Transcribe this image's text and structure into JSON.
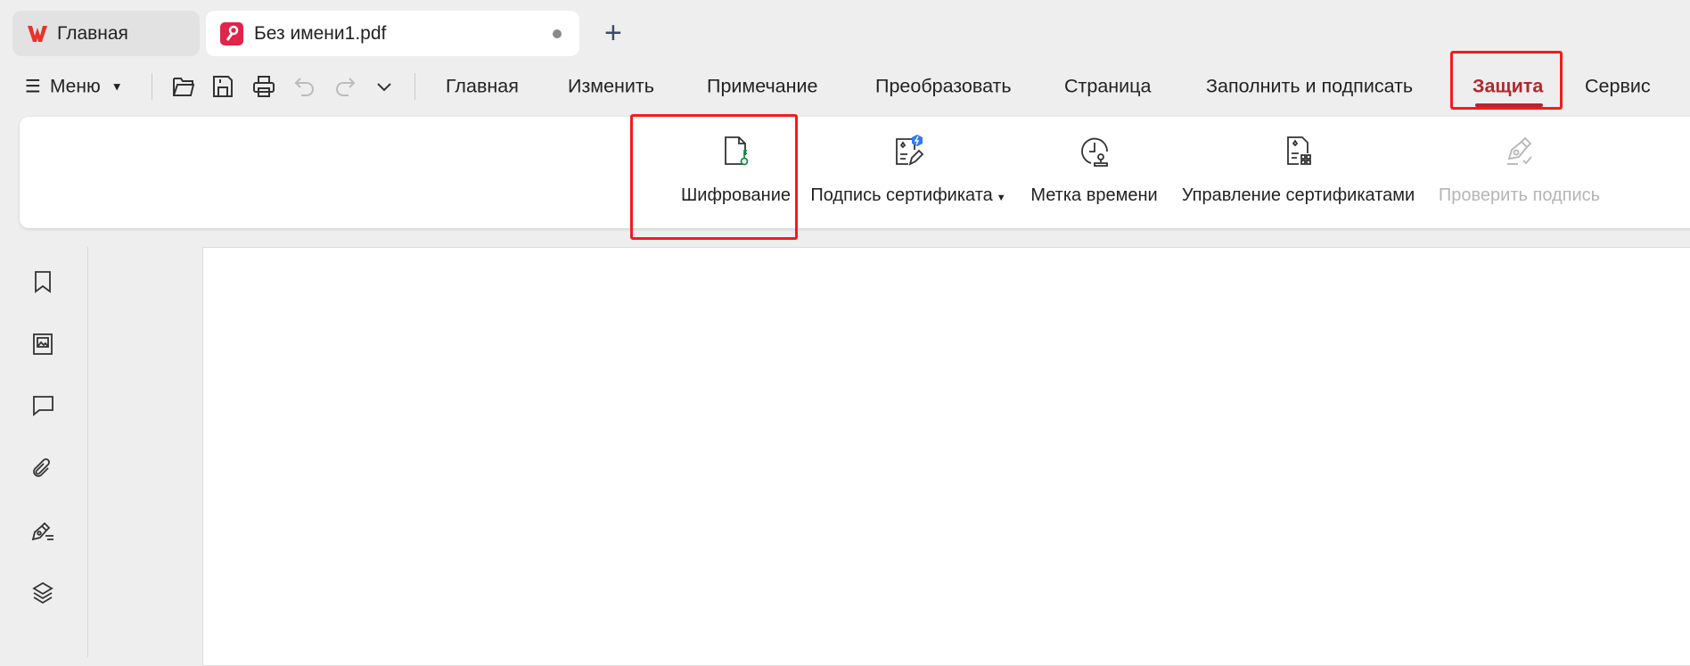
{
  "tabs": [
    {
      "label": "Главная",
      "icon": "wps-logo-icon"
    },
    {
      "label": "Без имени1.pdf",
      "icon": "pdf-icon",
      "unsaved": true
    }
  ],
  "new_tab_label": "+",
  "toolbar": {
    "menu_label": "Меню",
    "quick_icons": [
      "open-folder-icon",
      "save-icon",
      "print-icon",
      "undo-icon",
      "redo-icon",
      "chevron-down-icon"
    ]
  },
  "ribbon_tabs": [
    "Главная",
    "Изменить",
    "Примечание",
    "Преобразовать",
    "Страница",
    "Заполнить и подписать",
    "Защита",
    "Сервис"
  ],
  "active_tab": "Защита",
  "ribbon_buttons": [
    {
      "label": "Шифрование",
      "icon": "file-key-icon"
    },
    {
      "label": "Подпись сертификата",
      "icon": "certificate-sign-icon",
      "dropdown": true
    },
    {
      "label": "Метка времени",
      "icon": "timestamp-icon"
    },
    {
      "label": "Управление сертификатами",
      "icon": "certificate-manage-icon"
    },
    {
      "label": "Проверить подпись",
      "icon": "verify-signature-icon",
      "disabled": true
    }
  ],
  "sidebar_icons": [
    "bookmark-icon",
    "thumbnail-icon",
    "comment-icon",
    "attachment-icon",
    "signature-icon",
    "layers-icon"
  ],
  "colors": {
    "accent": "#b3262e",
    "highlight": "#f21c1c",
    "disabled": "#b5b5b5"
  }
}
